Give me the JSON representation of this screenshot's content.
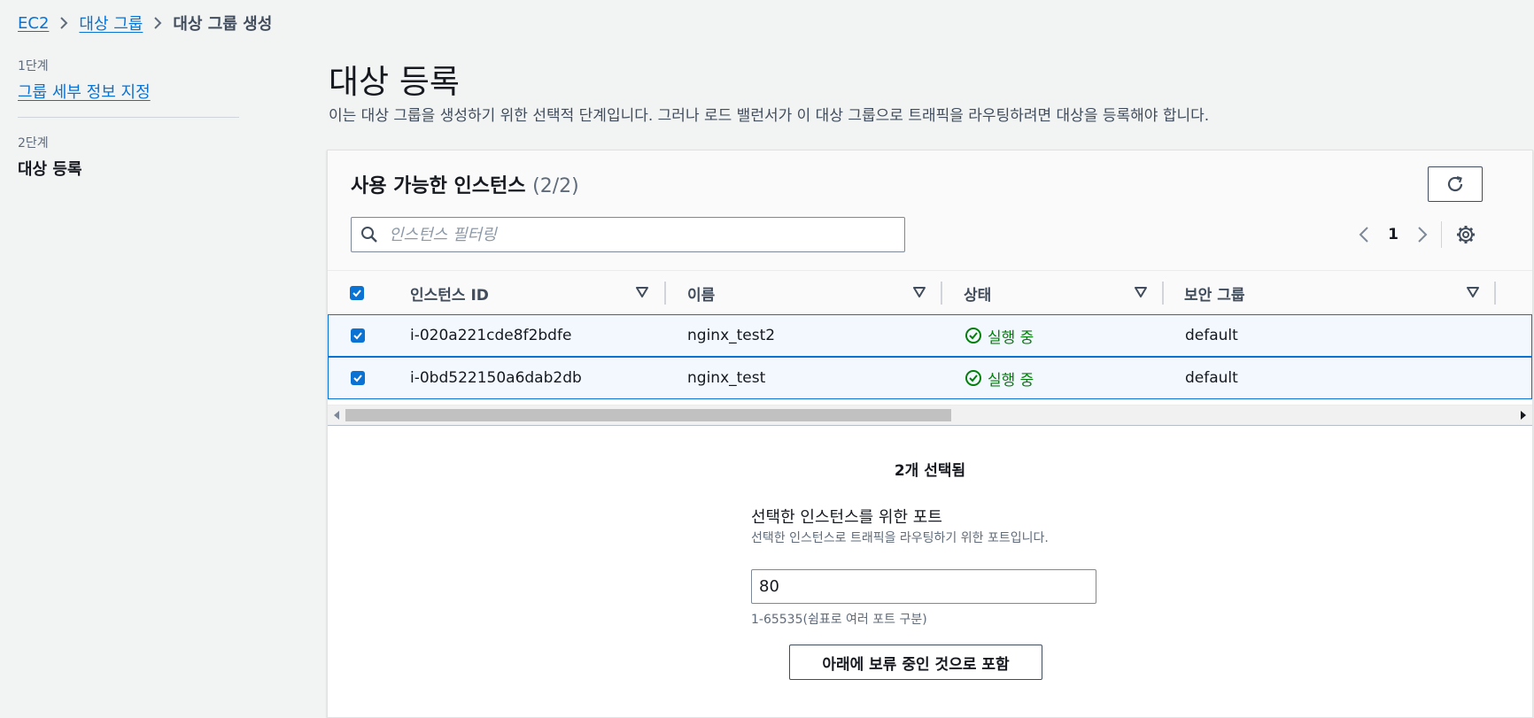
{
  "breadcrumb": {
    "items": [
      "EC2",
      "대상 그룹"
    ],
    "current": "대상 그룹 생성"
  },
  "side_nav": {
    "step1_label": "1단계",
    "step1_link": "그룹 세부 정보 지정",
    "step2_label": "2단계",
    "step2_current": "대상 등록"
  },
  "header": {
    "title": "대상 등록",
    "description": "이는 대상 그룹을 생성하기 위한 선택적 단계입니다. 그러나 로드 밸런서가 이 대상 그룹으로 트래픽을 라우팅하려면 대상을 등록해야 합니다."
  },
  "instances_panel": {
    "title": "사용 가능한 인스턴스",
    "count": "(2/2)",
    "filter_placeholder": "인스턴스 필터링",
    "page_number": "1",
    "columns": [
      "인스턴스 ID",
      "이름",
      "상태",
      "보안 그룹"
    ],
    "rows": [
      {
        "id": "i-020a221cde8f2bdfe",
        "name": "nginx_test2",
        "state": "실행 중",
        "sg": "default",
        "checked": true
      },
      {
        "id": "i-0bd522150a6dab2db",
        "name": "nginx_test",
        "state": "실행 중",
        "sg": "default",
        "checked": true
      }
    ]
  },
  "selection": {
    "count_text": "2개 선택됨",
    "port_label": "선택한 인스턴스를 위한 포트",
    "port_description": "선택한 인스턴스로 트래픽을 라우팅하기 위한 포트입니다.",
    "port_value": "80",
    "port_hint": "1-65535(쉼표로 여러 포트 구분)",
    "include_button": "아래에 보류 중인 것으로 포함"
  },
  "colors": {
    "link": "#0972d3",
    "success": "#037f0c",
    "row_selected_bg": "#f2f8fd"
  },
  "icons": [
    "chevron-right-icon",
    "refresh-icon",
    "search-icon",
    "chevron-left-icon",
    "settings-icon",
    "sort-caret-icon",
    "check-icon",
    "status-success-icon"
  ]
}
